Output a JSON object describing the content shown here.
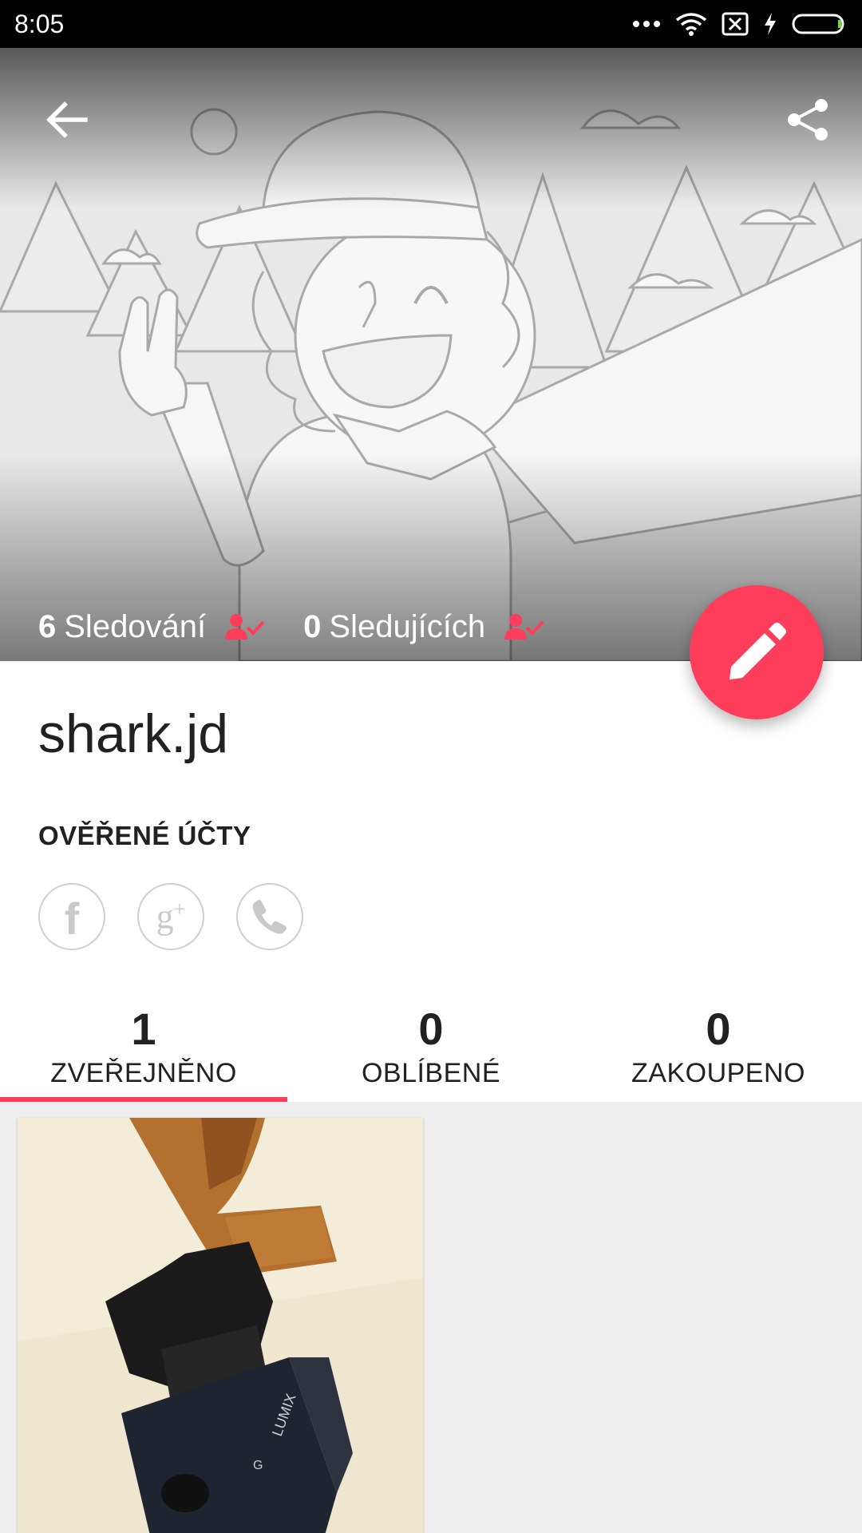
{
  "status_bar": {
    "time": "8:05"
  },
  "header": {
    "back_icon": "arrow-left-icon",
    "share_icon": "share-icon"
  },
  "stats": {
    "following_count": "6",
    "following_label": "Sledování",
    "followers_count": "0",
    "followers_label": "Sledujících"
  },
  "profile": {
    "username": "shark.jd",
    "verified_title": "OVĚŘENÉ ÚČTY",
    "verified_accounts": [
      "facebook-icon",
      "google-plus-icon",
      "phone-icon"
    ]
  },
  "tabs": [
    {
      "count": "1",
      "label": "ZVEŘEJNĚNO",
      "active": true
    },
    {
      "count": "0",
      "label": "OBLÍBENÉ",
      "active": false
    },
    {
      "count": "0",
      "label": "ZAKOUPENO",
      "active": false
    }
  ],
  "colors": {
    "accent": "#fe3d5a",
    "status_bar": "#000000",
    "grid_background": "#eeeeee"
  },
  "fab": {
    "icon": "pencil-icon"
  }
}
